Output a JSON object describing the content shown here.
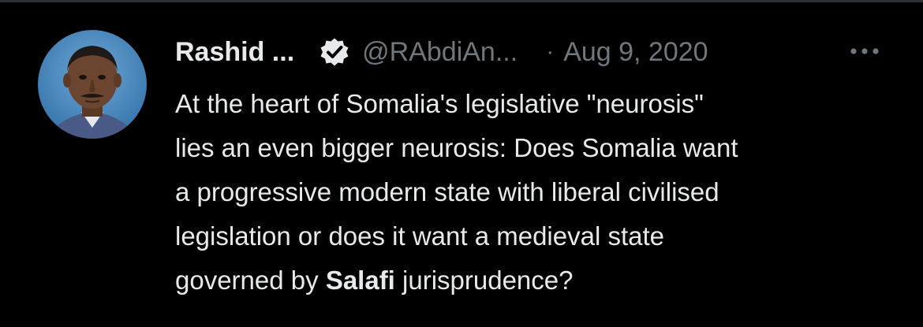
{
  "tweet": {
    "author_name": "Rashid ...",
    "handle": "@RAbdiAn...",
    "separator": "·",
    "date": "Aug 9, 2020",
    "verified": true,
    "avatar_icon": "profile-photo",
    "more_icon": "more-dots-icon",
    "text_lines": [
      "At the heart of Somalia's legislative \"neurosis\"",
      "lies an even bigger neurosis: Does Somalia want",
      "a progressive modern state with liberal civilised",
      "legislation or does it want a medieval state"
    ],
    "last_line": {
      "before": "governed by ",
      "bold": "Salafi",
      "after": " jurisprudence?"
    }
  },
  "colors": {
    "background": "#000000",
    "primary_text": "#e7e9ea",
    "secondary_text": "#71767b",
    "badge_fill": "#e7e9ea"
  }
}
